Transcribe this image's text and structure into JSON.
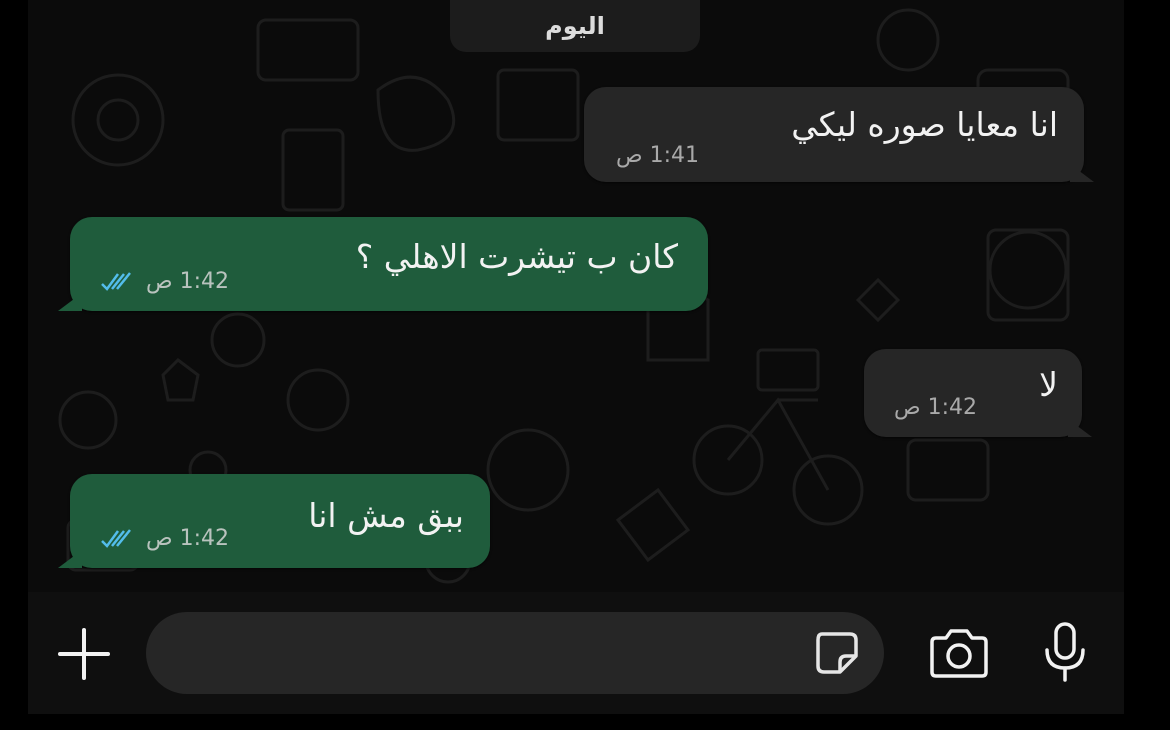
{
  "chat": {
    "date_chip": "اليوم",
    "messages": [
      {
        "direction": "incoming",
        "text": "انا معايا صوره ليكي",
        "time": "1:41 ص"
      },
      {
        "direction": "outgoing",
        "text": "كان ب تيشرت الاهلي ؟",
        "time": "1:42 ص",
        "read": true
      },
      {
        "direction": "incoming",
        "text": "لا",
        "time": "1:42 ص"
      },
      {
        "direction": "outgoing",
        "text": "ببق مش انا",
        "time": "1:42 ص",
        "read": true
      }
    ]
  },
  "composer": {
    "attach_icon": "plus-icon",
    "input_value": "",
    "sticker_icon": "sticker-icon",
    "camera_icon": "camera-icon",
    "mic_icon": "microphone-icon"
  },
  "colors": {
    "incoming_bubble": "#262626",
    "outgoing_bubble": "#1f5c3c",
    "read_ticks": "#53bdeb",
    "background": "#0b0b0b"
  }
}
